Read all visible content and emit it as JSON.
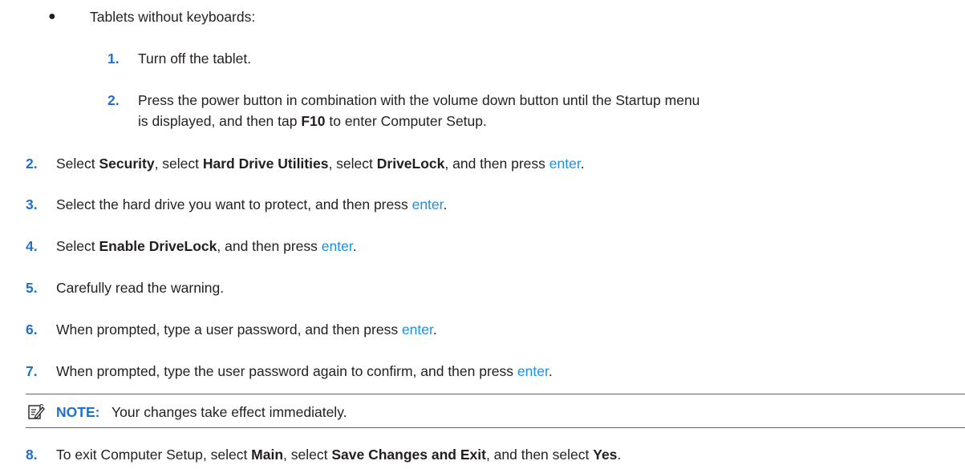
{
  "bullet_item": {
    "bullet": "●",
    "text": "Tablets without keyboards:"
  },
  "sub_steps": [
    {
      "num": "1.",
      "text": "Turn off the tablet."
    },
    {
      "num": "2.",
      "line1": "Press the power button in combination with the volume down button until the Startup menu",
      "line2_pre": "is displayed, and then tap ",
      "line2_bold": "F10",
      "line2_post": " to enter Computer Setup."
    }
  ],
  "steps": [
    {
      "num": "2.",
      "p1": "Select ",
      "b1": "Security",
      "p2": ", select ",
      "b2": "Hard Drive Utilities",
      "p3": ", select ",
      "b3": "DriveLock",
      "p4": ", and then press ",
      "key": "enter",
      "p5": "."
    },
    {
      "num": "3.",
      "pre": "Select the hard drive you want to protect, and then press ",
      "key": "enter",
      "post": "."
    },
    {
      "num": "4.",
      "pre": "Select ",
      "bold": "Enable DriveLock",
      "mid": ", and then press ",
      "key": "enter",
      "post": "."
    },
    {
      "num": "5.",
      "text": "Carefully read the warning."
    },
    {
      "num": "6.",
      "pre": "When prompted, type a user password, and then press ",
      "key": "enter",
      "post": "."
    },
    {
      "num": "7.",
      "pre": "When prompted, type the user password again to confirm, and then press ",
      "key": "enter",
      "post": "."
    },
    {
      "num": "8.",
      "p1": "To exit Computer Setup, select ",
      "b1": "Main",
      "p2": ", select ",
      "b2": "Save Changes and Exit",
      "p3": ", and then select ",
      "b3": "Yes",
      "p4": "."
    }
  ],
  "note": {
    "icon": "note-pencil-icon",
    "label": "NOTE:",
    "text": "Your changes take effect immediately."
  },
  "colors": {
    "accent": "#1f6fd0",
    "key": "#1f8ee0",
    "text": "#231f20"
  }
}
